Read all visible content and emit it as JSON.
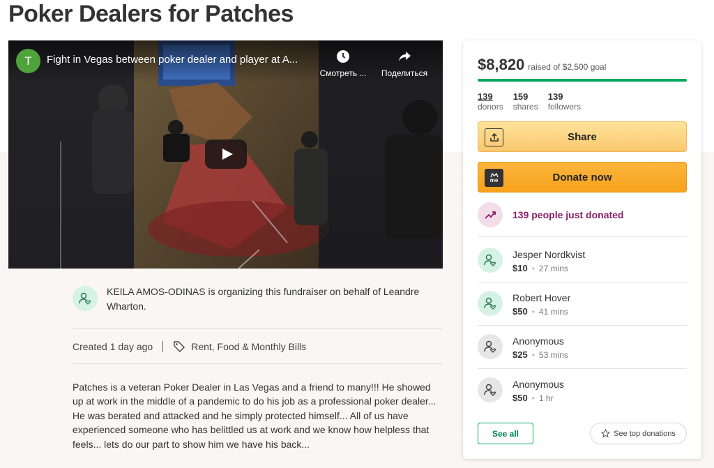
{
  "page": {
    "title": "Poker Dealers for Patches"
  },
  "video": {
    "channel_initial": "T",
    "title": "Fight in Vegas between poker dealer and player at A...",
    "watch_later_label": "Смотреть ...",
    "share_label": "Поделиться"
  },
  "organizer": {
    "text": "KEILA AMOS-ODINAS is organizing this fundraiser on behalf of Leandre Wharton."
  },
  "meta": {
    "created": "Created 1 day ago",
    "category": "Rent, Food & Monthly Bills"
  },
  "story": "Patches is a veteran Poker Dealer in Las Vegas and a friend to many!!! He showed up at work in the middle of a pandemic to do his job as a professional poker dealer... He was berated and attacked and he simply protected himself... All of us have experienced someone who has belittled us at work and we know how helpless that feels... lets do our part to show him we have his back...",
  "sidebar": {
    "amount": "$8,820",
    "goal_text": "raised of $2,500 goal",
    "progress_fraction": 1.0,
    "stats": [
      {
        "value": "139",
        "label": "donors"
      },
      {
        "value": "159",
        "label": "shares"
      },
      {
        "value": "139",
        "label": "followers"
      }
    ],
    "share_label": "Share",
    "donate_label": "Donate now",
    "donate_icon_text": "me",
    "trend_text": "139 people just donated",
    "donations": [
      {
        "name": "Jesper Nordkvist",
        "amount": "$10",
        "time": "27 mins",
        "avatar": "green"
      },
      {
        "name": "Robert Hover",
        "amount": "$50",
        "time": "41 mins",
        "avatar": "green"
      },
      {
        "name": "Anonymous",
        "amount": "$25",
        "time": "53 mins",
        "avatar": "grey"
      },
      {
        "name": "Anonymous",
        "amount": "$50",
        "time": "1 hr",
        "avatar": "grey"
      }
    ],
    "see_all_label": "See all",
    "top_donations_label": "See top donations"
  },
  "colors": {
    "accent_green": "#02a95c",
    "share_yellow": "#fbc76e",
    "donate_orange": "#f7a21b",
    "trend_purple": "#8c1d6a"
  }
}
